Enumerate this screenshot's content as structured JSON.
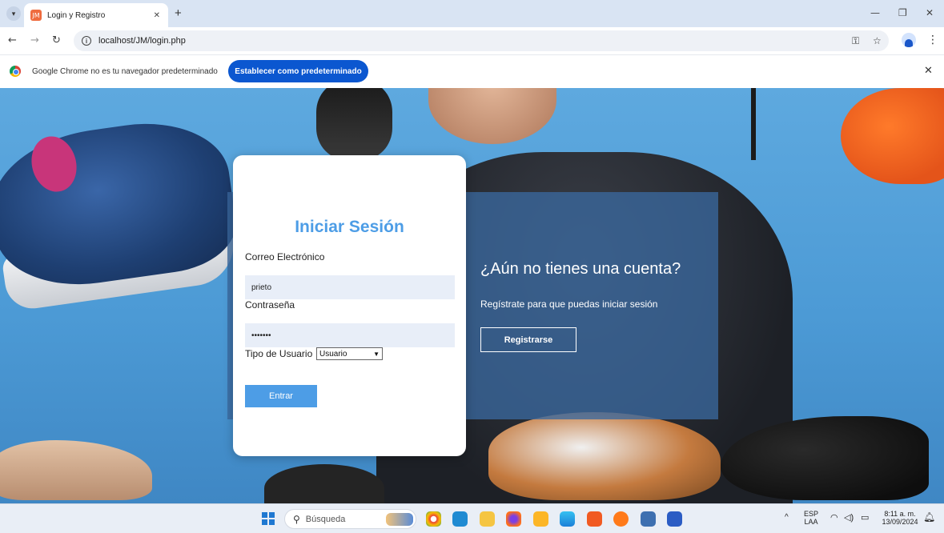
{
  "browser": {
    "tab_title": "Login y Registro",
    "tab_favicon": "JM",
    "new_tab": "+",
    "url": "localhost/JM/login.php"
  },
  "infobar": {
    "message": "Google Chrome no es tu navegador predeterminado",
    "button": "Establecer como predeterminado"
  },
  "login": {
    "title": "Iniciar Sesión",
    "email_label": "Correo Electrónico",
    "email_value": "prieto",
    "password_label": "Contraseña",
    "password_value": "•••••••",
    "user_type_label": "Tipo de Usuario",
    "user_type_value": "Usuario",
    "submit": "Entrar"
  },
  "signup": {
    "title": "¿Aún no tienes una cuenta?",
    "text": "Regístrate para que puedas iniciar sesión",
    "button": "Registrarse"
  },
  "taskbar": {
    "search_placeholder": "Búsqueda",
    "lang": "ESP",
    "lang_sub": "LAA",
    "time": "8:11 a. m.",
    "date": "13/09/2024"
  },
  "colors": {
    "accent": "#4d9de6",
    "chrome_blue": "#0b57d0",
    "panel": "#3a689e"
  }
}
